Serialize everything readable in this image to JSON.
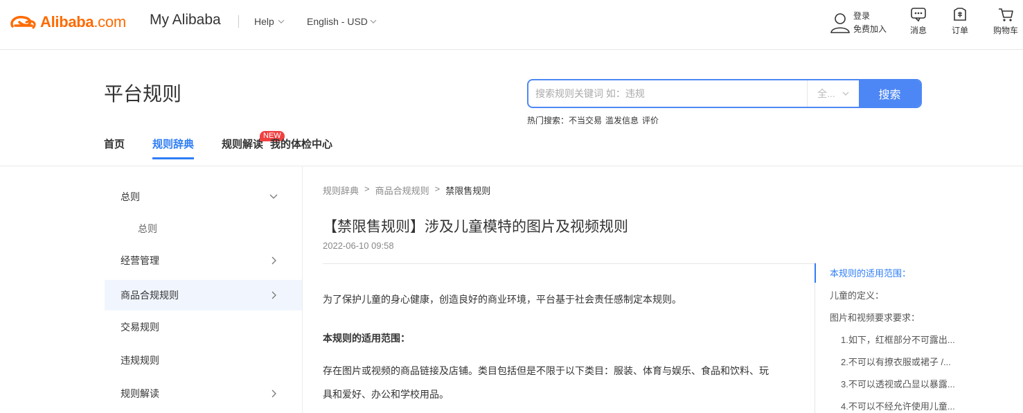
{
  "topbar": {
    "logo_brand": "Alibaba",
    "logo_suffix": ".com",
    "site_title": "My Alibaba",
    "help_label": "Help",
    "lang_label": "English - USD",
    "login_label": "登录",
    "register_label": "免费加入",
    "messages_label": "消息",
    "orders_label": "订单",
    "cart_label": "购物车"
  },
  "header": {
    "title": "平台规则",
    "search_placeholder": "搜索规则关键词 如：违规",
    "search_scope": "全...",
    "search_button": "搜索",
    "hot_search_label": "热门搜索：",
    "hot_terms": [
      "不当交易",
      "滥发信息",
      "评价"
    ]
  },
  "nav": {
    "items": [
      {
        "label": "首页"
      },
      {
        "label": "规则辞典"
      },
      {
        "label": "规则解读",
        "badge": "NEW"
      },
      {
        "label": "我的体检中心"
      }
    ]
  },
  "sidebar": {
    "items": [
      {
        "label": "总则"
      },
      {
        "label": "总则"
      },
      {
        "label": "经营管理"
      },
      {
        "label": "商品合规规则"
      },
      {
        "label": "交易规则"
      },
      {
        "label": "违规规则"
      },
      {
        "label": "规则解读"
      }
    ]
  },
  "breadcrumb": {
    "items": [
      "规则辞典",
      "商品合规规则",
      "禁限售规则"
    ],
    "separator": ">"
  },
  "article": {
    "title": "【禁限售规则】涉及儿童模特的图片及视频规则",
    "date": "2022-06-10 09:58",
    "intro": "为了保护儿童的身心健康，创造良好的商业环境，平台基于社会责任感制定本规则。",
    "scope_heading": "本规则的适用范围：",
    "scope_line1": "存在图片或视频的商品链接及店铺。类目包括但是不限于以下类目：服装、体育与娱乐、食品和饮料、玩",
    "scope_line2": "具和爱好、办公和学校用品。"
  },
  "toc": {
    "items": [
      {
        "label": "本规则的适用范围："
      },
      {
        "label": "儿童的定义："
      },
      {
        "label": "图片和视频要求要求："
      },
      {
        "label": "1.如下，红框部分不可露出..."
      },
      {
        "label": "2.不可以有撩衣服或裙子 /..."
      },
      {
        "label": "3.不可以透视或凸显以暴露..."
      },
      {
        "label": "4.不可以不经允许使用儿童..."
      }
    ]
  },
  "colors": {
    "brand_orange": "#ff6a00",
    "accent_blue": "#2e7df6",
    "search_blue": "#4d87f5",
    "badge_red": "#f04141",
    "sidebar_active_bg": "#f1f6fe"
  }
}
